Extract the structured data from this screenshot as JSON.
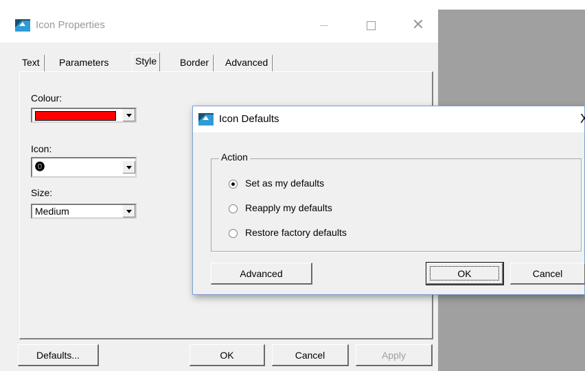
{
  "main_window": {
    "title": "Icon Properties",
    "tabs": [
      "Text",
      "Parameters",
      "Style",
      "Border",
      "Advanced"
    ],
    "active_tab": "Style",
    "style": {
      "colour_label": "Colour:",
      "colour_value": "#ff0000",
      "icon_label": "Icon:",
      "icon_value": "⓿",
      "size_label": "Size:",
      "size_value": "Medium"
    },
    "buttons": {
      "defaults": "Defaults...",
      "ok": "OK",
      "cancel": "Cancel",
      "apply": "Apply"
    }
  },
  "dialog": {
    "title": "Icon Defaults",
    "close": "X",
    "group_label": "Action",
    "options": [
      {
        "label": "Set as my defaults",
        "checked": true
      },
      {
        "label": "Reapply my defaults",
        "checked": false
      },
      {
        "label": "Restore factory defaults",
        "checked": false
      }
    ],
    "buttons": {
      "advanced": "Advanced",
      "ok": "OK",
      "cancel": "Cancel"
    }
  },
  "icons": {
    "app_icon": "app-icon",
    "minimize": "minimize-icon",
    "maximize": "maximize-icon",
    "close": "close-icon"
  }
}
